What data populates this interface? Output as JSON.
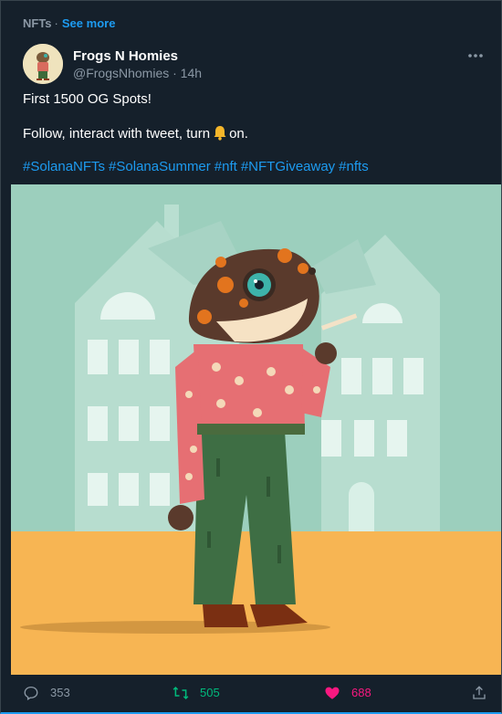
{
  "topic": {
    "label": "NFTs",
    "separator": "·",
    "see_more": "See more"
  },
  "tweet": {
    "author_name": "Frogs N Homies",
    "handle_time": "@FrogsNhomies · 14h",
    "line1": "First 1500 OG Spots!",
    "line2_before": "Follow, interact with tweet, turn",
    "line2_icon": "bell-icon",
    "line2_after": "on.",
    "hashtags": [
      "#SolanaNFTs",
      "#SolanaSummer",
      "#nft",
      "#NFTGiveaway",
      "#nfts"
    ]
  },
  "actions": {
    "replies": "353",
    "retweets": "505",
    "likes": "688"
  },
  "colors": {
    "background": "#15202b",
    "accent": "#1d9bf0",
    "retweet": "#00ba7c",
    "like": "#f91880",
    "muted": "#8b98a5"
  }
}
